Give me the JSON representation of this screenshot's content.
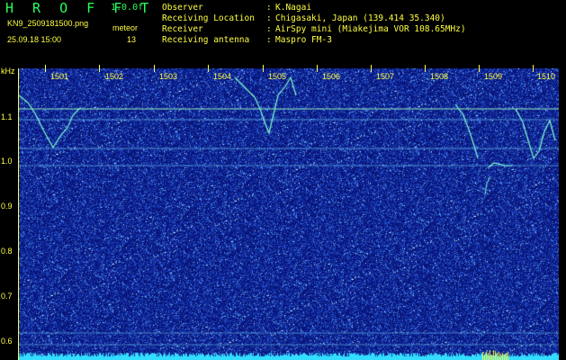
{
  "header": {
    "brand": "H R O F F T",
    "version": "1.0.0f",
    "filename": "KN9_2509181500.png",
    "meteor_label": "meteor",
    "datetime": "25.09.18 15:00",
    "meteor_count": "13",
    "fields": [
      {
        "label": "Observer",
        "sep": ":",
        "value": "K.Nagai"
      },
      {
        "label": "Receiving Location",
        "sep": ":",
        "value": "Chigasaki, Japan (139.414 35.340)"
      },
      {
        "label": "Receiver",
        "sep": ":",
        "value": "AirSpy mini (Miakejima VOR 108.65MHz)"
      },
      {
        "label": "Receiving antenna",
        "sep": ":",
        "value": "Maspro FM-3"
      }
    ]
  },
  "axis": {
    "y_unit": "kHz",
    "y_ticks": [
      "1.1",
      "1.0",
      "0.9",
      "0.8",
      "0.7",
      "0.6"
    ],
    "x_ticks": [
      "1501",
      "1502",
      "1503",
      "1504",
      "1505",
      "1506",
      "1507",
      "1508",
      "1509",
      "1510"
    ]
  },
  "colors": {
    "background": "#000000",
    "text": "#ffff40",
    "brand": "#2bff5a",
    "spectrogram_bg": "#0a1890",
    "carrier": "#7fffd0",
    "bottom_band": "#33ddff"
  }
}
